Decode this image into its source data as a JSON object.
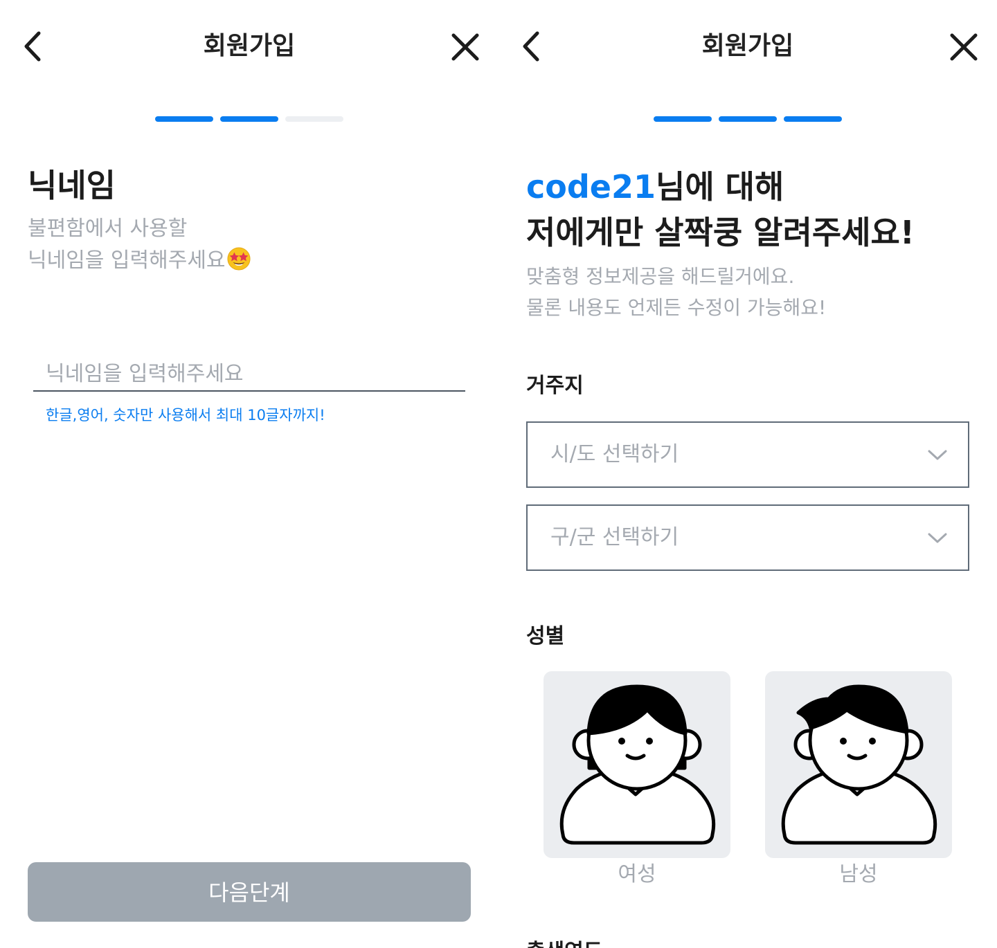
{
  "left": {
    "title": "회원가입",
    "steps": [
      true,
      true,
      false
    ],
    "heading": "닉네임",
    "sub_line1": "불편함에서 사용할",
    "sub_line2": "닉네임을 입력해주세요",
    "emoji_icon": "star-struck-emoji-icon",
    "input_placeholder": "닉네임을 입력해주세요",
    "input_value": "",
    "hint": "한글,영어, 숫자만 사용해서 최대 10글자까지!",
    "next_label": "다음단계"
  },
  "right": {
    "title": "회원가입",
    "steps": [
      true,
      true,
      true
    ],
    "username": "code21",
    "heading_suffix": "님에 대해",
    "heading_line2": "저에게만 살짝쿵 알려주세요!",
    "sub_line1": "맞춤형 정보제공을 해드릴거에요.",
    "sub_line2": "물론 내용도 언제든 수정이 가능해요!",
    "residence_label": "거주지",
    "city_placeholder": "시/도 선택하기",
    "district_placeholder": "구/군 선택하기",
    "gender_label": "성별",
    "female_label": "여성",
    "male_label": "남성",
    "next_section_label": "출생연도"
  },
  "colors": {
    "accent": "#0a7df0",
    "progress_inactive": "#edeff2",
    "placeholder": "#a4a9b0",
    "disabled_button": "#9ea7b0",
    "gender_card": "#ebedf0"
  },
  "icons": {
    "back": "chevron-left-icon",
    "close": "close-icon",
    "dropdown": "chevron-down-icon"
  }
}
